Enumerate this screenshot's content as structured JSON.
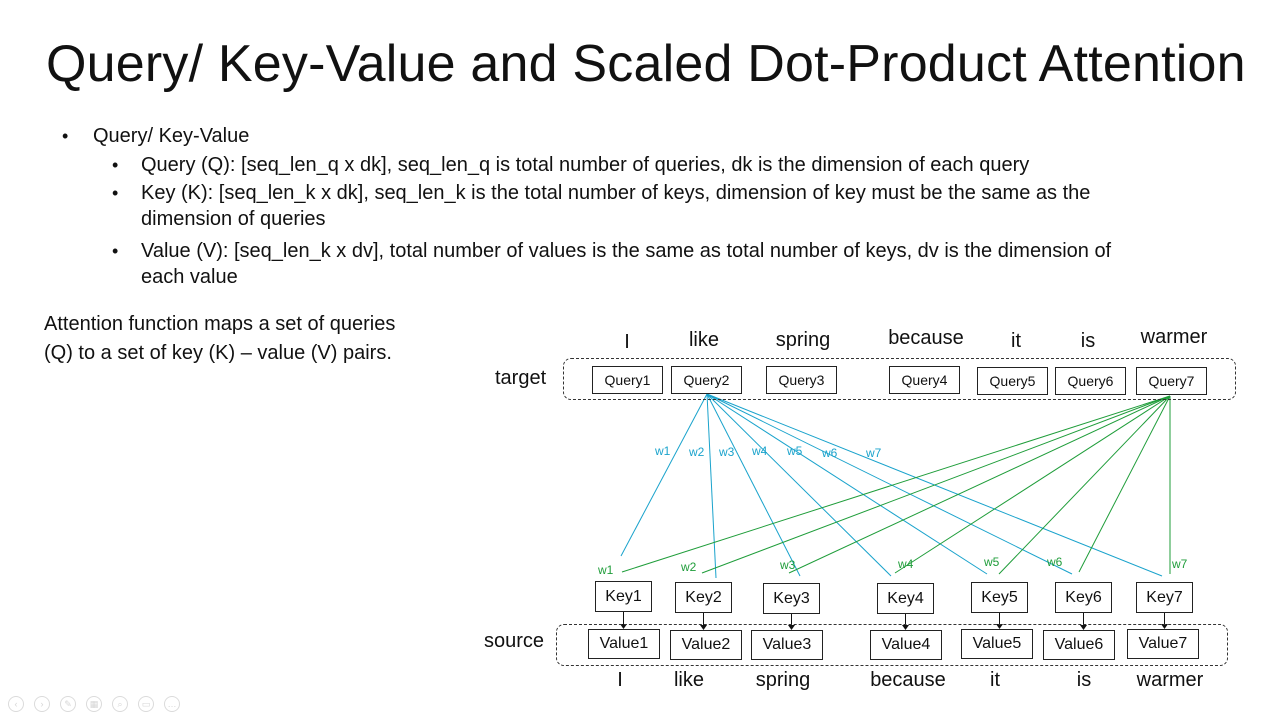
{
  "title": "Query/ Key-Value and Scaled Dot-Product Attention",
  "bullets": {
    "heading": "Query/ Key-Value",
    "query": "Query (Q):  [seq_len_q x dk], seq_len_q is total number of queries, dk is the dimension of each query",
    "key_line1": "Key (K): [seq_len_k x dk], seq_len_k is the total number of keys, dimension of key must be the same as the",
    "key_line2": "dimension of queries",
    "value_line1": "Value (V): [seq_len_k x dv], total number of values is the same as total number of keys, dv is the dimension of",
    "value_line2": "each value"
  },
  "note": {
    "line1": "Attention function maps a set of queries",
    "line2": "(Q) to a set of key (K) – value (V) pairs."
  },
  "diagram": {
    "target_label": "target",
    "source_label": "source",
    "target_words": [
      "I",
      "like",
      "spring",
      "because",
      "it",
      "is",
      "warmer"
    ],
    "source_words": [
      "I",
      "like",
      "spring",
      "because",
      "it",
      "is",
      "warmer"
    ],
    "queries": [
      "Query1",
      "Query2",
      "Query3",
      "Query4",
      "Query5",
      "Query6",
      "Query7"
    ],
    "keys": [
      "Key1",
      "Key2",
      "Key3",
      "Key4",
      "Key5",
      "Key6",
      "Key7"
    ],
    "values": [
      "Value1",
      "Value2",
      "Value3",
      "Value4",
      "Value5",
      "Value6",
      "Value7"
    ],
    "blue_weights": [
      "w1",
      "w2",
      "w3",
      "w4",
      "w5",
      "w6",
      "w7"
    ],
    "green_weights": [
      "w1",
      "w2",
      "w3",
      "w4",
      "w5",
      "w6",
      "w7"
    ],
    "colors": {
      "query2_links": "#1aa3cc",
      "query7_links": "#1f9d3a"
    }
  }
}
